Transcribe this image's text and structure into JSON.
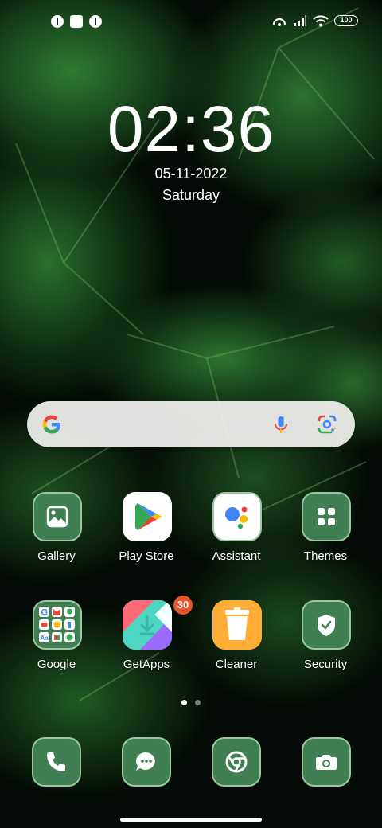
{
  "status_bar": {
    "battery": "100"
  },
  "clock": {
    "time": "02:36",
    "date": "05-11-2022",
    "day": "Saturday"
  },
  "search_bar": {
    "icons": [
      "google-g-icon",
      "mic-icon",
      "lens-icon"
    ]
  },
  "apps": [
    {
      "label": "Gallery",
      "icon": "gallery-icon"
    },
    {
      "label": "Play Store",
      "icon": "play-store-icon"
    },
    {
      "label": "Assistant",
      "icon": "assistant-icon"
    },
    {
      "label": "Themes",
      "icon": "themes-icon"
    },
    {
      "label": "Google",
      "icon": "google-folder-icon"
    },
    {
      "label": "GetApps",
      "icon": "getapps-icon",
      "badge": "30"
    },
    {
      "label": "Cleaner",
      "icon": "cleaner-icon"
    },
    {
      "label": "Security",
      "icon": "security-icon"
    }
  ],
  "page_indicator": {
    "pages": 2,
    "current": 1
  },
  "dock": [
    {
      "icon": "phone-icon"
    },
    {
      "icon": "messages-icon"
    },
    {
      "icon": "chrome-icon"
    },
    {
      "icon": "camera-icon"
    }
  ],
  "colors": {
    "icon_tile": "#3f7f52",
    "icon_border": "#9cc6a4",
    "badge": "#e8542b"
  }
}
